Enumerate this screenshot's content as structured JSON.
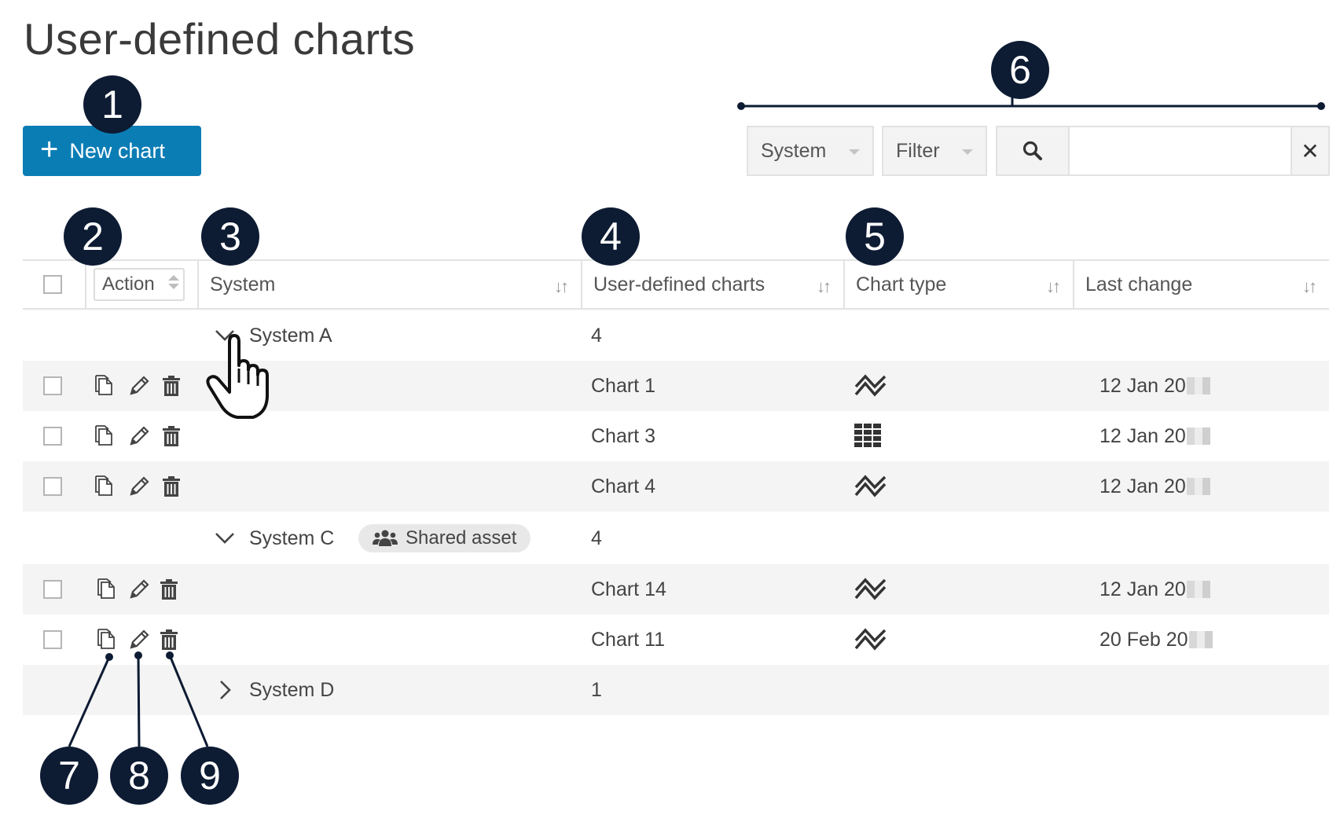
{
  "page": {
    "title": "User-defined charts"
  },
  "toolbar": {
    "new_chart_label": "New chart",
    "system_select": "System",
    "filter_select": "Filter",
    "search_value": "",
    "clear_label": "✕"
  },
  "table": {
    "headers": {
      "action": "Action",
      "system": "System",
      "charts": "User-defined charts",
      "chart_type": "Chart type",
      "last_change": "Last change"
    },
    "groups": [
      {
        "name": "System A",
        "count": "4",
        "expanded": true,
        "badge": ""
      },
      {
        "name": "System C",
        "count": "4",
        "expanded": true,
        "badge": "Shared asset"
      },
      {
        "name": "System D",
        "count": "1",
        "expanded": false,
        "badge": ""
      }
    ],
    "rows": [
      {
        "chart": "Chart 1",
        "type_icon": "line-chart-icon",
        "last_change": "12 Jan 20"
      },
      {
        "chart": "Chart 3",
        "type_icon": "table-chart-icon",
        "last_change": "12 Jan 20"
      },
      {
        "chart": "Chart 4",
        "type_icon": "line-chart-icon",
        "last_change": "12 Jan 20"
      },
      {
        "chart": "Chart 14",
        "type_icon": "line-chart-icon",
        "last_change": "12 Jan 20"
      },
      {
        "chart": "Chart 11",
        "type_icon": "line-chart-icon",
        "last_change": "20 Feb 20"
      }
    ]
  },
  "callouts": [
    "1",
    "2",
    "3",
    "4",
    "5",
    "6",
    "7",
    "8",
    "9"
  ],
  "colors": {
    "accent": "#0b7db5",
    "callout": "#0d1b33",
    "row_shade": "#f4f4f4"
  }
}
